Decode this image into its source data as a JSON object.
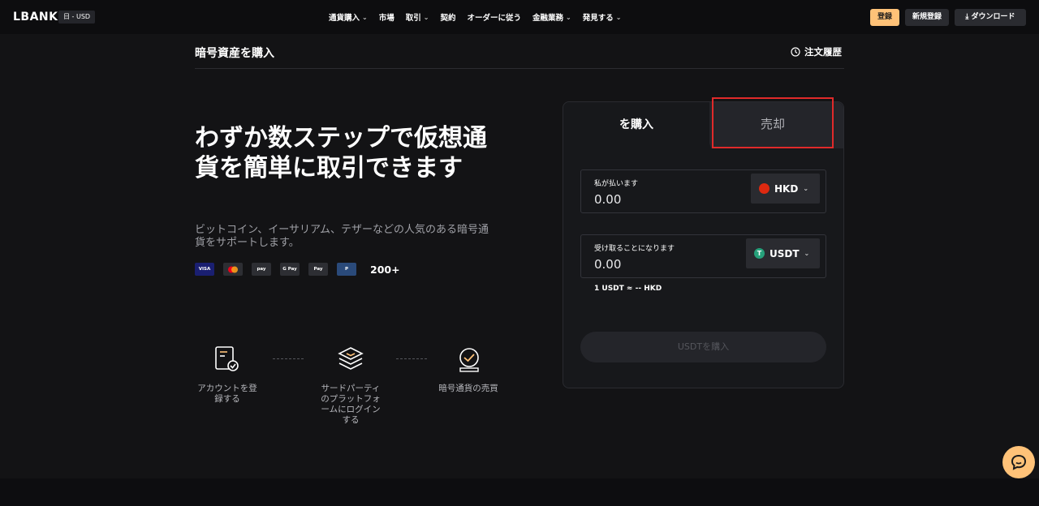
{
  "header": {
    "logo": "LBANK",
    "locale": "日 - USD",
    "nav": [
      {
        "label": "通貨購入",
        "dropdown": true
      },
      {
        "label": "市場",
        "dropdown": false
      },
      {
        "label": "取引",
        "dropdown": true
      },
      {
        "label": "契約",
        "dropdown": false
      },
      {
        "label": "オーダーに従う",
        "dropdown": false
      },
      {
        "label": "金融業務",
        "dropdown": true
      },
      {
        "label": "発見する",
        "dropdown": true
      }
    ],
    "login_label": "登録",
    "register_label": "新規登録",
    "download_label": "ダウンロード"
  },
  "page": {
    "title": "暗号資産を購入",
    "history_label": "注文履歴"
  },
  "hero": {
    "headline": "わずか数ステップで仮想通貨を簡単に取引できます",
    "subtext": "ビットコイン、イーサリアム、テザーなどの人気のある暗号通貨をサポートします。",
    "payment_methods": [
      "VISA",
      "Mastercard",
      "Samsung Pay",
      "G Pay",
      "Apple Pay",
      "PayPal"
    ],
    "more_count": "200+"
  },
  "steps": [
    {
      "label": "アカウントを登録する",
      "icon": "document-check-icon"
    },
    {
      "label": "サードパーティのプラットフォームにログインする",
      "icon": "layers-icon"
    },
    {
      "label": "暗号通貨の売買",
      "icon": "badge-check-icon"
    }
  ],
  "trade": {
    "tab_buy": "を購入",
    "tab_sell": "売却",
    "pay_label": "私が払います",
    "pay_value": "0.00",
    "pay_currency": "HKD",
    "receive_label": "受け取ることになります",
    "receive_value": "0.00",
    "receive_currency": "USDT",
    "rate": "1 USDT ≈ -- HKD",
    "buy_button": "USDTを購入"
  },
  "colors": {
    "accent": "#ffc278",
    "background": "#131315",
    "highlight_box": "#e02a2a",
    "usdt": "#26a17b",
    "hkd": "#de2910"
  }
}
